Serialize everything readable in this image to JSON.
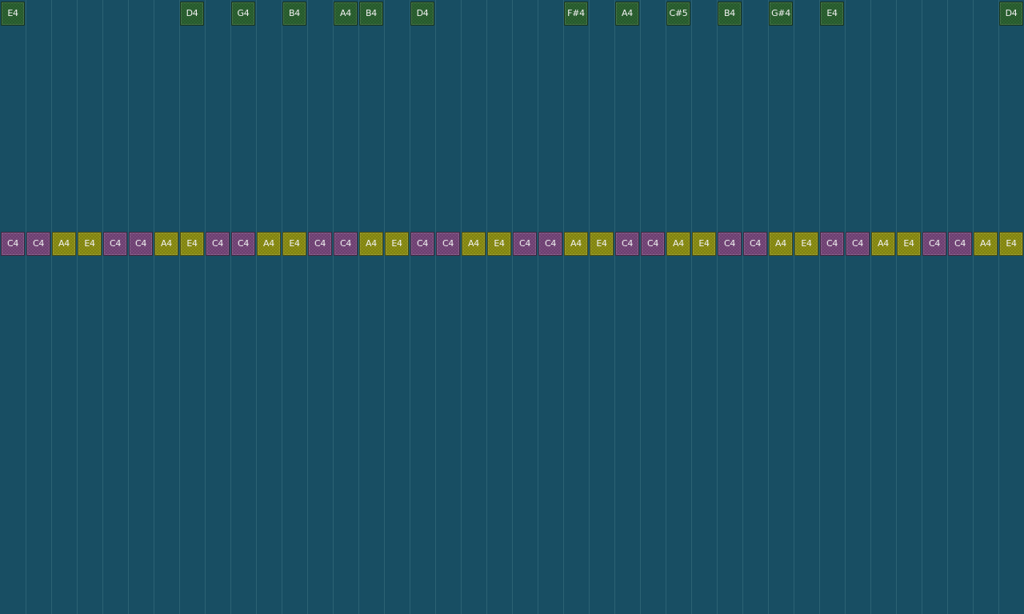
{
  "colors": {
    "background": "#184e63",
    "gridline": "#2c6274",
    "melody_note": "#2d6533",
    "harmony_note_purple": "#7a4a7e",
    "harmony_note_yellow": "#8f9216",
    "note_text": "#f2f2f2"
  },
  "grid": {
    "columns": 40
  },
  "melody_track": {
    "notes": [
      {
        "step": 1,
        "label": "E4"
      },
      {
        "step": 8,
        "label": "D4"
      },
      {
        "step": 10,
        "label": "G4"
      },
      {
        "step": 12,
        "label": "B4"
      },
      {
        "step": 14,
        "label": "A4"
      },
      {
        "step": 15,
        "label": "B4"
      },
      {
        "step": 17,
        "label": "D4"
      },
      {
        "step": 23,
        "label": "F#4"
      },
      {
        "step": 25,
        "label": "A4"
      },
      {
        "step": 27,
        "label": "C#5"
      },
      {
        "step": 29,
        "label": "B4"
      },
      {
        "step": 31,
        "label": "G#4"
      },
      {
        "step": 33,
        "label": "E4"
      },
      {
        "step": 40,
        "label": "D4"
      }
    ]
  },
  "harmony_track": {
    "notes": [
      {
        "step": 1,
        "label": "C4",
        "color": "purple"
      },
      {
        "step": 2,
        "label": "C4",
        "color": "purple"
      },
      {
        "step": 3,
        "label": "A4",
        "color": "yellow"
      },
      {
        "step": 4,
        "label": "E4",
        "color": "yellow"
      },
      {
        "step": 5,
        "label": "C4",
        "color": "purple"
      },
      {
        "step": 6,
        "label": "C4",
        "color": "purple"
      },
      {
        "step": 7,
        "label": "A4",
        "color": "yellow"
      },
      {
        "step": 8,
        "label": "E4",
        "color": "yellow"
      },
      {
        "step": 9,
        "label": "C4",
        "color": "purple"
      },
      {
        "step": 10,
        "label": "C4",
        "color": "purple"
      },
      {
        "step": 11,
        "label": "A4",
        "color": "yellow"
      },
      {
        "step": 12,
        "label": "E4",
        "color": "yellow"
      },
      {
        "step": 13,
        "label": "C4",
        "color": "purple"
      },
      {
        "step": 14,
        "label": "C4",
        "color": "purple"
      },
      {
        "step": 15,
        "label": "A4",
        "color": "yellow"
      },
      {
        "step": 16,
        "label": "E4",
        "color": "yellow"
      },
      {
        "step": 17,
        "label": "C4",
        "color": "purple"
      },
      {
        "step": 18,
        "label": "C4",
        "color": "purple"
      },
      {
        "step": 19,
        "label": "A4",
        "color": "yellow"
      },
      {
        "step": 20,
        "label": "E4",
        "color": "yellow"
      },
      {
        "step": 21,
        "label": "C4",
        "color": "purple"
      },
      {
        "step": 22,
        "label": "C4",
        "color": "purple"
      },
      {
        "step": 23,
        "label": "A4",
        "color": "yellow"
      },
      {
        "step": 24,
        "label": "E4",
        "color": "yellow"
      },
      {
        "step": 25,
        "label": "C4",
        "color": "purple"
      },
      {
        "step": 26,
        "label": "C4",
        "color": "purple"
      },
      {
        "step": 27,
        "label": "A4",
        "color": "yellow"
      },
      {
        "step": 28,
        "label": "E4",
        "color": "yellow"
      },
      {
        "step": 29,
        "label": "C4",
        "color": "purple"
      },
      {
        "step": 30,
        "label": "C4",
        "color": "purple"
      },
      {
        "step": 31,
        "label": "A4",
        "color": "yellow"
      },
      {
        "step": 32,
        "label": "E4",
        "color": "yellow"
      },
      {
        "step": 33,
        "label": "C4",
        "color": "purple"
      },
      {
        "step": 34,
        "label": "C4",
        "color": "purple"
      },
      {
        "step": 35,
        "label": "A4",
        "color": "yellow"
      },
      {
        "step": 36,
        "label": "E4",
        "color": "yellow"
      },
      {
        "step": 37,
        "label": "C4",
        "color": "purple"
      },
      {
        "step": 38,
        "label": "C4",
        "color": "purple"
      },
      {
        "step": 39,
        "label": "A4",
        "color": "yellow"
      },
      {
        "step": 40,
        "label": "E4",
        "color": "yellow"
      }
    ]
  }
}
